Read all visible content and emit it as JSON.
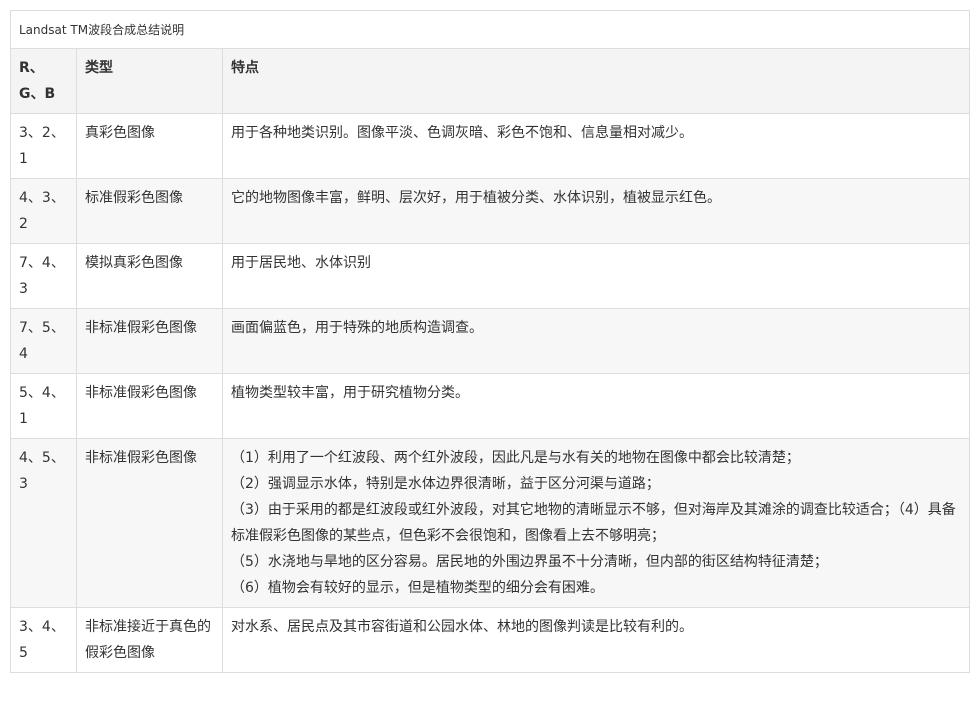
{
  "table": {
    "caption": "Landsat TM波段合成总结说明",
    "headers": [
      "R、G、B",
      "类型",
      "特点"
    ],
    "rows": [
      {
        "rgb": "3、2、1",
        "type": "真彩色图像",
        "features": [
          "用于各种地类识别。图像平淡、色调灰暗、彩色不饱和、信息量相对减少。"
        ]
      },
      {
        "rgb": "4、3、2",
        "type": "标准假彩色图像",
        "features": [
          "它的地物图像丰富，鲜明、层次好，用于植被分类、水体识别，植被显示红色。"
        ]
      },
      {
        "rgb": "7、4、3",
        "type": "模拟真彩色图像",
        "features": [
          "用于居民地、水体识别"
        ]
      },
      {
        "rgb": "7、5、4",
        "type": "非标准假彩色图像",
        "features": [
          "画面偏蓝色，用于特殊的地质构造调查。"
        ]
      },
      {
        "rgb": "5、4、1",
        "type": "非标准假彩色图像",
        "features": [
          "植物类型较丰富，用于研究植物分类。"
        ]
      },
      {
        "rgb": "4、5、3",
        "type": "非标准假彩色图像",
        "features": [
          "（1）利用了一个红波段、两个红外波段，因此凡是与水有关的地物在图像中都会比较清楚；",
          "（2）强调显示水体，特别是水体边界很清晰，益于区分河渠与道路；",
          "（3）由于采用的都是红波段或红外波段，对其它地物的清晰显示不够，但对海岸及其滩涂的调查比较适合；（4）具备标准假彩色图像的某些点，但色彩不会很饱和，图像看上去不够明亮；",
          "（5）水浇地与旱地的区分容易。居民地的外围边界虽不十分清晰，但内部的街区结构特征清楚；",
          "（6）植物会有较好的显示，但是植物类型的细分会有困难。"
        ]
      },
      {
        "rgb": "3、4、5",
        "type": "非标准接近于真色的假彩色图像",
        "features": [
          "对水系、居民点及其市容街道和公园水体、林地的图像判读是比较有利的。"
        ]
      }
    ]
  }
}
